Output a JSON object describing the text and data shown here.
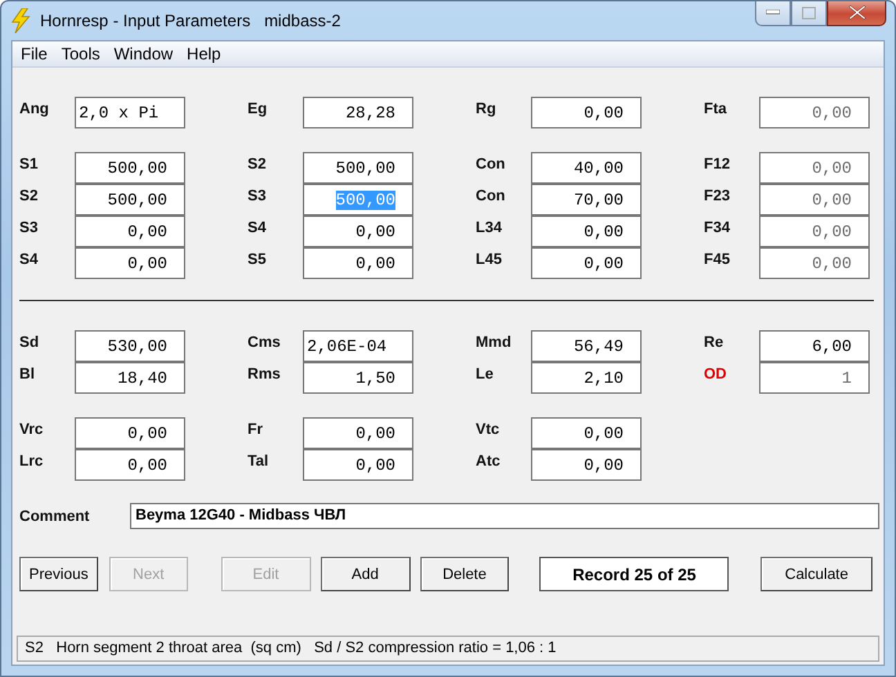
{
  "window": {
    "title": "Hornresp - Input Parameters   midbass-2"
  },
  "menu": [
    {
      "label": "File"
    },
    {
      "label": "Tools"
    },
    {
      "label": "Window"
    },
    {
      "label": "Help"
    }
  ],
  "upper_blocks": [
    {
      "rows": [
        [
          {
            "label": "Ang",
            "value": "2,0 x Pi",
            "kind": "text",
            "disabled": false,
            "selected": false,
            "alert": false
          },
          {
            "label": "Eg",
            "value": "28,28",
            "kind": "number",
            "disabled": false,
            "selected": false,
            "alert": false
          },
          {
            "label": "Rg",
            "value": "0,00",
            "kind": "number",
            "disabled": false,
            "selected": false,
            "alert": false
          },
          {
            "label": "Fta",
            "value": "0,00",
            "kind": "number",
            "disabled": true,
            "selected": false,
            "alert": false
          }
        ]
      ]
    },
    {
      "rows": [
        [
          {
            "label": "S1",
            "value": "500,00",
            "kind": "number",
            "disabled": false,
            "selected": false,
            "alert": false
          },
          {
            "label": "S2",
            "value": "500,00",
            "kind": "number",
            "disabled": false,
            "selected": false,
            "alert": false
          },
          {
            "label": "Con",
            "value": "40,00",
            "kind": "number",
            "disabled": false,
            "selected": false,
            "alert": false
          },
          {
            "label": "F12",
            "value": "0,00",
            "kind": "number",
            "disabled": true,
            "selected": false,
            "alert": false
          }
        ],
        [
          {
            "label": "S2",
            "value": "500,00",
            "kind": "number",
            "disabled": false,
            "selected": false,
            "alert": false
          },
          {
            "label": "S3",
            "value": "500,00",
            "kind": "number",
            "disabled": false,
            "selected": true,
            "alert": false
          },
          {
            "label": "Con",
            "value": "70,00",
            "kind": "number",
            "disabled": false,
            "selected": false,
            "alert": false
          },
          {
            "label": "F23",
            "value": "0,00",
            "kind": "number",
            "disabled": true,
            "selected": false,
            "alert": false
          }
        ],
        [
          {
            "label": "S3",
            "value": "0,00",
            "kind": "number",
            "disabled": false,
            "selected": false,
            "alert": false
          },
          {
            "label": "S4",
            "value": "0,00",
            "kind": "number",
            "disabled": false,
            "selected": false,
            "alert": false
          },
          {
            "label": "L34",
            "value": "0,00",
            "kind": "number",
            "disabled": false,
            "selected": false,
            "alert": false
          },
          {
            "label": "F34",
            "value": "0,00",
            "kind": "number",
            "disabled": true,
            "selected": false,
            "alert": false
          }
        ],
        [
          {
            "label": "S4",
            "value": "0,00",
            "kind": "number",
            "disabled": false,
            "selected": false,
            "alert": false
          },
          {
            "label": "S5",
            "value": "0,00",
            "kind": "number",
            "disabled": false,
            "selected": false,
            "alert": false
          },
          {
            "label": "L45",
            "value": "0,00",
            "kind": "number",
            "disabled": false,
            "selected": false,
            "alert": false
          },
          {
            "label": "F45",
            "value": "0,00",
            "kind": "number",
            "disabled": true,
            "selected": false,
            "alert": false
          }
        ]
      ]
    }
  ],
  "lower_blocks": [
    {
      "rows": [
        [
          {
            "label": "Sd",
            "value": "530,00",
            "kind": "number",
            "disabled": false,
            "selected": false,
            "alert": false
          },
          {
            "label": "Cms",
            "value": "2,06E-04",
            "kind": "text",
            "disabled": false,
            "selected": false,
            "alert": false
          },
          {
            "label": "Mmd",
            "value": "56,49",
            "kind": "number",
            "disabled": false,
            "selected": false,
            "alert": false
          },
          {
            "label": "Re",
            "value": "6,00",
            "kind": "number",
            "disabled": false,
            "selected": false,
            "alert": false
          }
        ],
        [
          {
            "label": "Bl",
            "value": "18,40",
            "kind": "number",
            "disabled": false,
            "selected": false,
            "alert": false
          },
          {
            "label": "Rms",
            "value": "1,50",
            "kind": "number",
            "disabled": false,
            "selected": false,
            "alert": false
          },
          {
            "label": "Le",
            "value": "2,10",
            "kind": "number",
            "disabled": false,
            "selected": false,
            "alert": false
          },
          {
            "label": "OD",
            "value": "1",
            "kind": "number",
            "disabled": true,
            "selected": false,
            "alert": true
          }
        ]
      ]
    },
    {
      "rows": [
        [
          {
            "label": "Vrc",
            "value": "0,00",
            "kind": "number",
            "disabled": false,
            "selected": false,
            "alert": false
          },
          {
            "label": "Fr",
            "value": "0,00",
            "kind": "number",
            "disabled": false,
            "selected": false,
            "alert": false
          },
          {
            "label": "Vtc",
            "value": "0,00",
            "kind": "number",
            "disabled": false,
            "selected": false,
            "alert": false
          }
        ],
        [
          {
            "label": "Lrc",
            "value": "0,00",
            "kind": "number",
            "disabled": false,
            "selected": false,
            "alert": false
          },
          {
            "label": "Tal",
            "value": "0,00",
            "kind": "number",
            "disabled": false,
            "selected": false,
            "alert": false
          },
          {
            "label": "Atc",
            "value": "0,00",
            "kind": "number",
            "disabled": false,
            "selected": false,
            "alert": false
          }
        ]
      ]
    }
  ],
  "comment": {
    "label": "Comment",
    "value": "Beyma 12G40 - Midbass ЧВЛ"
  },
  "buttons": [
    {
      "label": "Previous",
      "disabled": false
    },
    {
      "label": "Next",
      "disabled": true
    },
    {
      "label": "Edit",
      "disabled": true
    },
    {
      "label": "Add",
      "disabled": false
    },
    {
      "label": "Delete",
      "disabled": false
    }
  ],
  "record": "Record 25 of 25",
  "calculate": {
    "label": "Calculate",
    "disabled": false
  },
  "status_bar": "S2   Horn segment 2 throat area  (sq cm)   Sd / S2 compression ratio = 1,06 : 1"
}
